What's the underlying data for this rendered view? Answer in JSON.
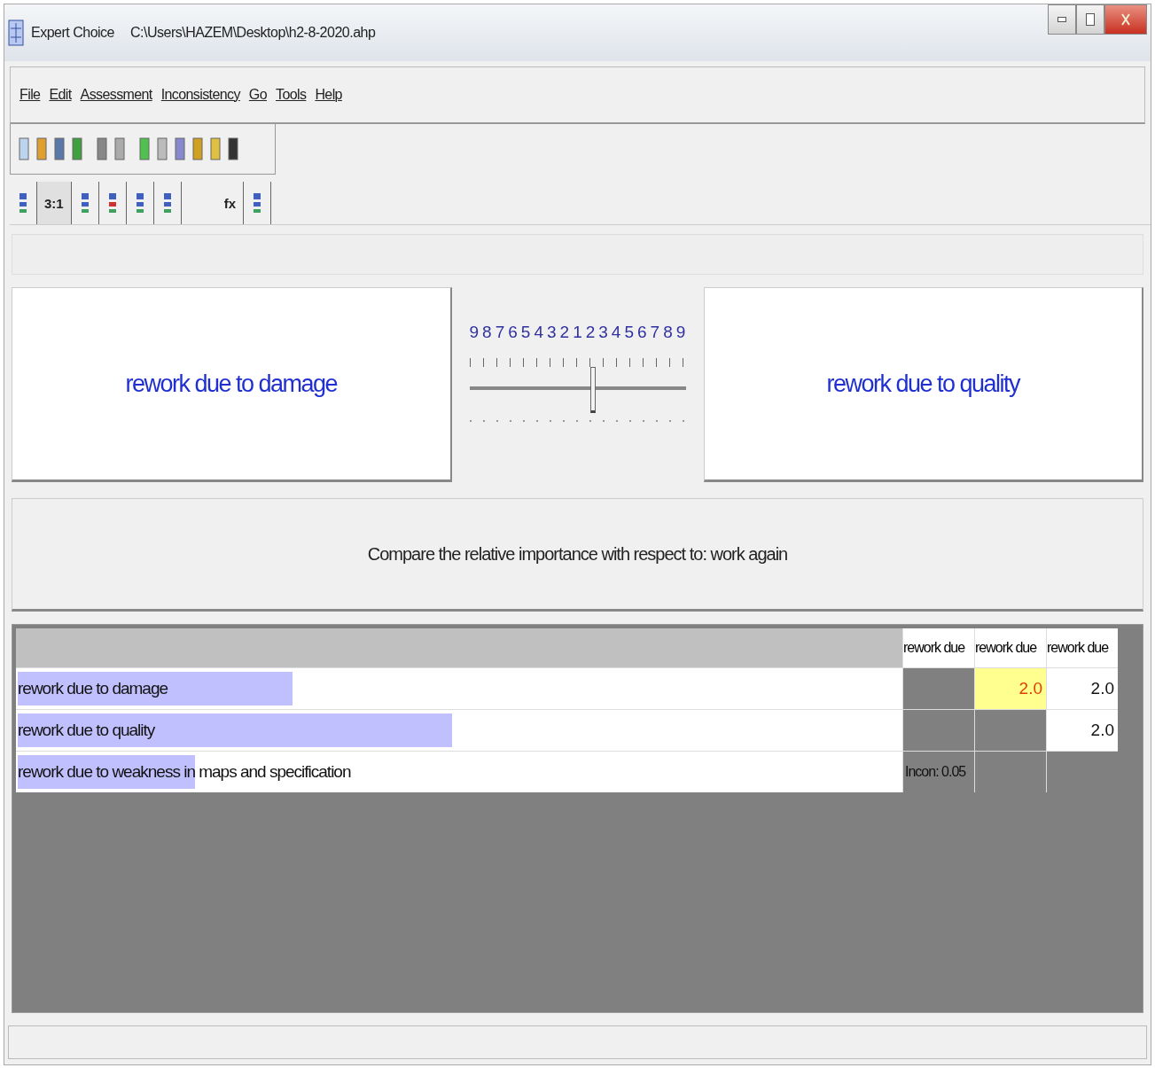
{
  "window": {
    "title": "Expert Choice",
    "file_path": "C:\\Users\\HAZEM\\Desktop\\h2-8-2020.ahp"
  },
  "menu": [
    "File",
    "Edit",
    "Assessment",
    "Inconsistency",
    "Go",
    "Tools",
    "Help"
  ],
  "tabs": [
    {
      "kind": "icon",
      "selected": false
    },
    {
      "kind": "text",
      "label": "3:1",
      "selected": true
    },
    {
      "kind": "icon",
      "selected": false
    },
    {
      "kind": "icon",
      "selected": false
    },
    {
      "kind": "icon",
      "selected": false
    },
    {
      "kind": "icon",
      "selected": false
    },
    {
      "kind": "text",
      "label": "fx",
      "selected": false
    },
    {
      "kind": "icon",
      "selected": false
    }
  ],
  "comparison": {
    "left": "rework due to damage",
    "right": "rework due to quality",
    "scale": [
      "9",
      "8",
      "7",
      "6",
      "5",
      "4",
      "3",
      "2",
      "1",
      "2",
      "3",
      "4",
      "5",
      "6",
      "7",
      "8",
      "9"
    ],
    "slider": {
      "level": 0.57
    }
  },
  "message": "Compare the relative importance with respect to: work again",
  "matrix": {
    "columns": [
      "rework due",
      "rework due",
      "rework due"
    ],
    "rows": [
      {
        "name": "rework due to damage",
        "level": 0.31,
        "cells": [
          {
            "kind": "blank"
          },
          {
            "kind": "value",
            "value": "2.0",
            "selected": true
          },
          {
            "kind": "value",
            "value": "2.0",
            "selected": false
          }
        ]
      },
      {
        "name": "rework due to quality",
        "level": 0.49,
        "cells": [
          {
            "kind": "blank"
          },
          {
            "kind": "blank"
          },
          {
            "kind": "value",
            "value": "2.0",
            "selected": false
          }
        ]
      },
      {
        "name": "rework due to weakness in maps and specification",
        "level": 0.2,
        "cells": [
          {
            "kind": "note",
            "value": "Incon: 0.05"
          },
          {
            "kind": "blank"
          },
          {
            "kind": "blank"
          }
        ]
      }
    ]
  }
}
